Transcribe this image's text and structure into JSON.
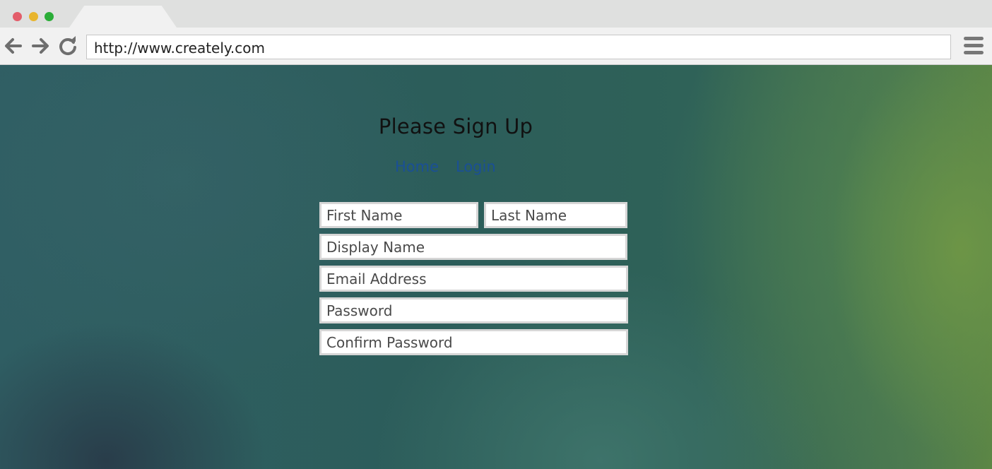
{
  "browser": {
    "url": "http://www.creately.com",
    "icons": {
      "back": "arrow-left-icon",
      "forward": "arrow-right-icon",
      "reload": "reload-icon",
      "menu": "hamburger-menu-icon"
    },
    "colors": {
      "close": "#e35d6a",
      "minimize": "#e8b52d",
      "maximize": "#2aad37"
    }
  },
  "page": {
    "heading": "Please Sign Up",
    "nav": {
      "home": "Home",
      "login": "Login"
    },
    "form": {
      "first_name_placeholder": "First Name",
      "last_name_placeholder": "Last Name",
      "display_name_placeholder": "Display Name",
      "email_placeholder": "Email Address",
      "password_placeholder": "Password",
      "confirm_password_placeholder": "Confirm Password"
    },
    "colors": {
      "link": "#1a4f96",
      "heading": "#111111"
    }
  }
}
